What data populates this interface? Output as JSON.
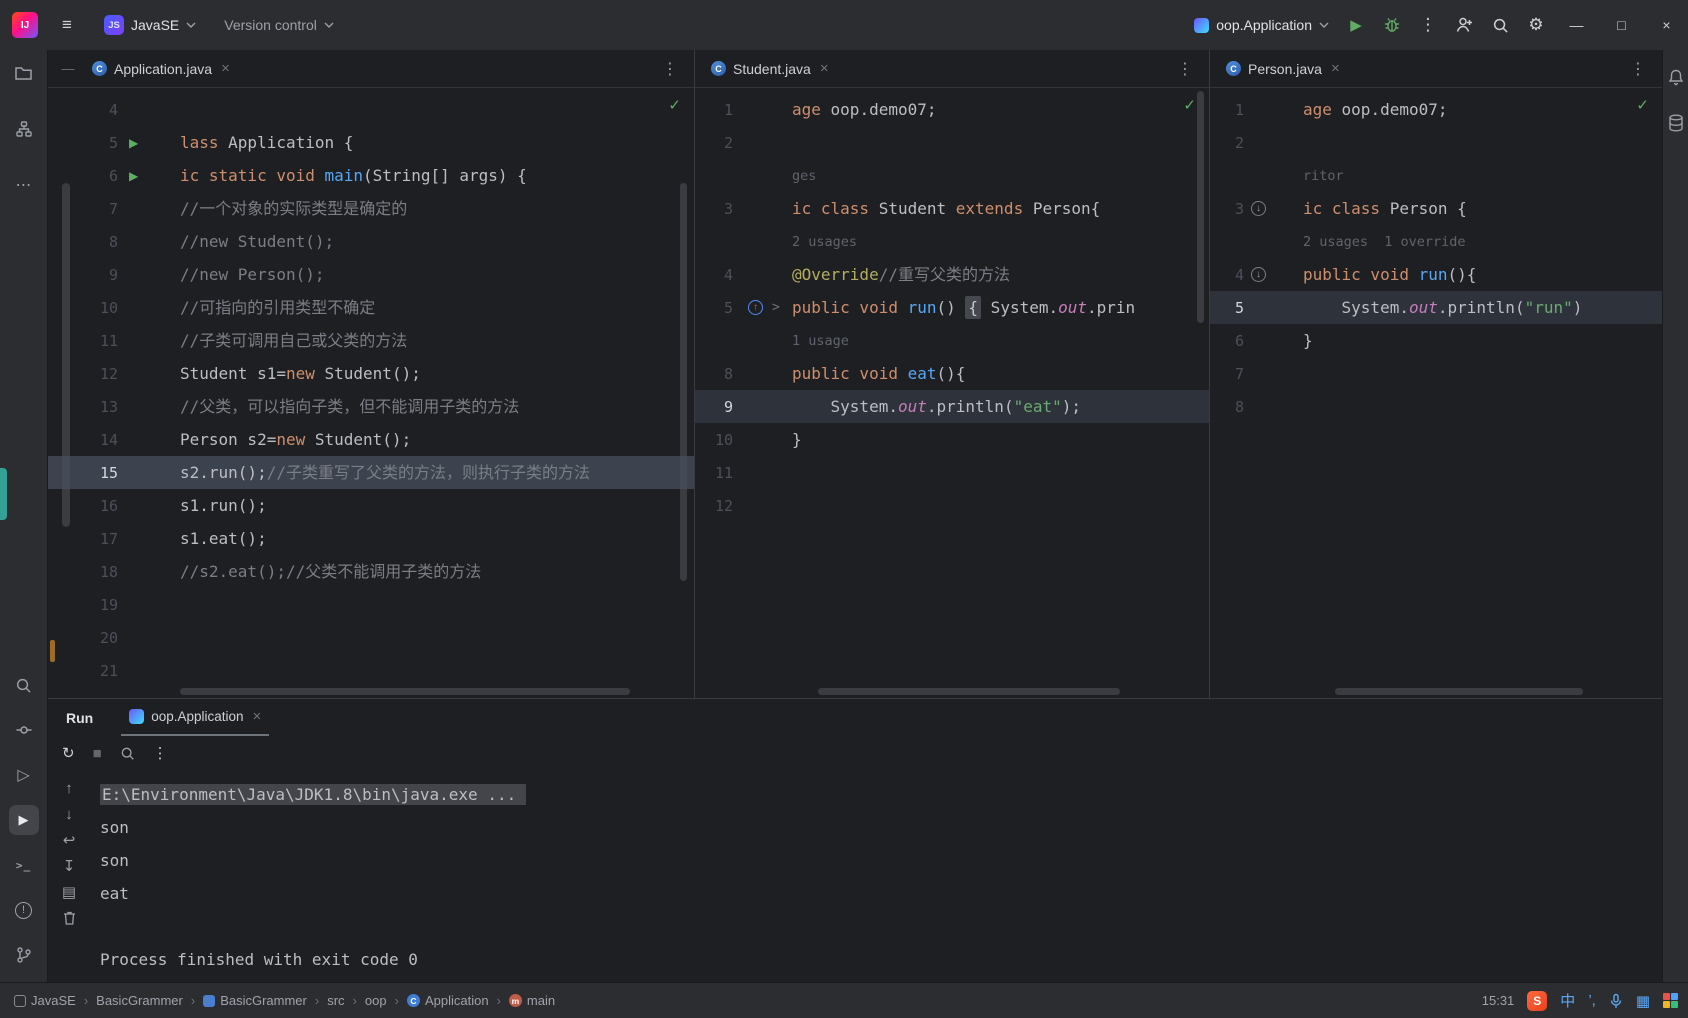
{
  "titlebar": {
    "logo": "IJ",
    "project_badge": "JS",
    "project_name": "JavaSE",
    "vcs_widget": "Version control",
    "run_config": "oop.Application"
  },
  "icons": {
    "menu": "≡",
    "more_v": "⋮",
    "more_h": "⋯",
    "gear": "⚙",
    "min": "—",
    "max": "□",
    "close": "×",
    "handle": "—",
    "play": "▶",
    "stop": "■",
    "rerun": "↻",
    "up": "↑",
    "down": "↓",
    "softwrap": "↩",
    "scrollend": "↧",
    "print": "▤",
    "services": "▷",
    "terminal": ">_",
    "problems": "!",
    "check": "✓",
    "run_glyph": "▶",
    "fold": ">",
    "ovr_up": "↑",
    "ovr_down": "↓",
    "class_letter": "C",
    "method_letter": "m",
    "separator": "›",
    "keyboard": "▦",
    "punct": "’,"
  },
  "colors": {
    "accent_blue": "#3574f0",
    "run_green": "#5fad65",
    "keyword": "#cf8e6d",
    "comment": "#7a7e85",
    "string": "#6aab73",
    "method": "#56a8f5",
    "field": "#c77dbb",
    "annotation": "#b3ae60"
  },
  "panes": [
    {
      "tab": "Application.java",
      "lines": [
        {
          "no": "4",
          "seg": []
        },
        {
          "no": "5",
          "g": "run",
          "seg": [
            [
              "lass",
              "kw"
            ],
            [
              " Application {",
              "id"
            ]
          ]
        },
        {
          "no": "6",
          "g": "run",
          "seg": [
            [
              "ic static void ",
              "kw"
            ],
            [
              "main",
              "fn"
            ],
            [
              "(String[] args) {",
              "id"
            ]
          ]
        },
        {
          "no": "7",
          "seg": [
            [
              "//一个对象的实际类型是确定的",
              "cm"
            ]
          ]
        },
        {
          "no": "8",
          "seg": [
            [
              "//new Student();",
              "cm"
            ]
          ]
        },
        {
          "no": "9",
          "seg": [
            [
              "//new Person();",
              "cm"
            ]
          ]
        },
        {
          "no": "10",
          "seg": [
            [
              "//可指向的引用类型不确定",
              "cm"
            ]
          ]
        },
        {
          "no": "11",
          "seg": [
            [
              "//子类可调用自己或父类的方法",
              "cm"
            ]
          ]
        },
        {
          "no": "12",
          "seg": [
            [
              "Student s1=",
              "id"
            ],
            [
              "new",
              "kw"
            ],
            [
              " Student();",
              "id"
            ]
          ]
        },
        {
          "no": "13",
          "seg": [
            [
              "//父类，可以指向子类，但不能调用子类的方法",
              "cm"
            ]
          ]
        },
        {
          "no": "14",
          "seg": [
            [
              "Person s2=",
              "id"
            ],
            [
              "new",
              "kw"
            ],
            [
              " Student();",
              "id"
            ]
          ]
        },
        {
          "no": "15",
          "hl": "sel",
          "seg": [
            [
              "s2.run();",
              "id"
            ],
            [
              "//子类重写了父类的方法，则执行子类的方法",
              "cm"
            ]
          ]
        },
        {
          "no": "16",
          "seg": [
            [
              "s1.run();",
              "id"
            ]
          ]
        },
        {
          "no": "17",
          "seg": [
            [
              "s1.eat();",
              "id"
            ]
          ]
        },
        {
          "no": "18",
          "seg": [
            [
              "//s2.eat();//父类不能调用子类的方法",
              "cm"
            ]
          ]
        },
        {
          "no": "19",
          "seg": []
        },
        {
          "no": "20",
          "seg": []
        },
        {
          "no": "21",
          "seg": []
        }
      ]
    },
    {
      "tab": "Student.java",
      "lines": [
        {
          "no": "1",
          "seg": [
            [
              "age",
              "kw"
            ],
            [
              " oop.demo07;",
              "id"
            ]
          ]
        },
        {
          "no": "2",
          "seg": []
        },
        {
          "hint": "ges"
        },
        {
          "no": "3",
          "seg": [
            [
              "ic class",
              "kw"
            ],
            [
              " Student ",
              "id"
            ],
            [
              "extends",
              "kw"
            ],
            [
              " Person{",
              "id"
            ]
          ]
        },
        {
          "hint": "2 usages"
        },
        {
          "no": "4",
          "seg": [
            [
              "@Override",
              "ann"
            ],
            [
              "//重写父类的方法",
              "cm"
            ]
          ]
        },
        {
          "no": "5",
          "g": "ovr-up",
          "fold": true,
          "seg": [
            [
              "public void ",
              "kw"
            ],
            [
              "run",
              "fn"
            ],
            [
              "() ",
              "id"
            ],
            [
              "{",
              "foldsel"
            ],
            [
              " System.",
              "id"
            ],
            [
              "out",
              "fld"
            ],
            [
              ".prin",
              "id"
            ]
          ]
        },
        {
          "hint": "1 usage"
        },
        {
          "no": "8",
          "seg": [
            [
              "public void ",
              "kw"
            ],
            [
              "eat",
              "fn"
            ],
            [
              "(){",
              "id"
            ]
          ]
        },
        {
          "no": "9",
          "hl": "caret",
          "seg": [
            [
              "    System.",
              "id"
            ],
            [
              "out",
              "fld"
            ],
            [
              ".println(",
              "id"
            ],
            [
              "\"eat\"",
              "str"
            ],
            [
              ");",
              "id"
            ]
          ]
        },
        {
          "no": "10",
          "seg": [
            [
              "}",
              "id"
            ]
          ]
        },
        {
          "no": "11",
          "seg": []
        },
        {
          "no": "12",
          "seg": []
        }
      ]
    },
    {
      "tab": "Person.java",
      "lines": [
        {
          "no": "1",
          "seg": [
            [
              "age",
              "kw"
            ],
            [
              " oop.demo07;",
              "id"
            ]
          ]
        },
        {
          "no": "2",
          "seg": []
        },
        {
          "hint": "ritor"
        },
        {
          "no": "3",
          "g": "ovr-down",
          "seg": [
            [
              "ic class",
              "kw"
            ],
            [
              " Person {",
              "id"
            ]
          ]
        },
        {
          "hint": "2 usages  1 override"
        },
        {
          "no": "4",
          "g": "ovr-down",
          "seg": [
            [
              "public void ",
              "kw"
            ],
            [
              "run",
              "fn"
            ],
            [
              "(){",
              "id"
            ]
          ]
        },
        {
          "no": "5",
          "hl": "caret",
          "seg": [
            [
              "    System.",
              "id"
            ],
            [
              "out",
              "fld"
            ],
            [
              ".println(",
              "id"
            ],
            [
              "\"run\"",
              "str"
            ],
            [
              ")",
              "id"
            ]
          ]
        },
        {
          "no": "6",
          "seg": [
            [
              "}",
              "id"
            ]
          ]
        },
        {
          "no": "7",
          "seg": []
        },
        {
          "no": "8",
          "seg": []
        }
      ]
    }
  ],
  "run_panel": {
    "title": "Run",
    "tab_label": "oop.Application",
    "console_lines": [
      {
        "text": "E:\\Environment\\Java\\JDK1.8\\bin\\java.exe ...",
        "sel": true
      },
      {
        "text": "son"
      },
      {
        "text": "son"
      },
      {
        "text": "eat"
      },
      {
        "text": ""
      },
      {
        "text": "Process finished with exit code 0"
      }
    ]
  },
  "status_bar": {
    "breadcrumbs": [
      {
        "label": "JavaSE",
        "icon": "project"
      },
      {
        "label": "BasicGrammer"
      },
      {
        "label": "BasicGrammer",
        "icon": "module"
      },
      {
        "label": "src"
      },
      {
        "label": "oop"
      },
      {
        "label": "Application",
        "icon": "class"
      },
      {
        "label": "main",
        "icon": "method"
      }
    ],
    "time": "15:31",
    "ime": {
      "logo": "S",
      "lang": "中"
    }
  }
}
